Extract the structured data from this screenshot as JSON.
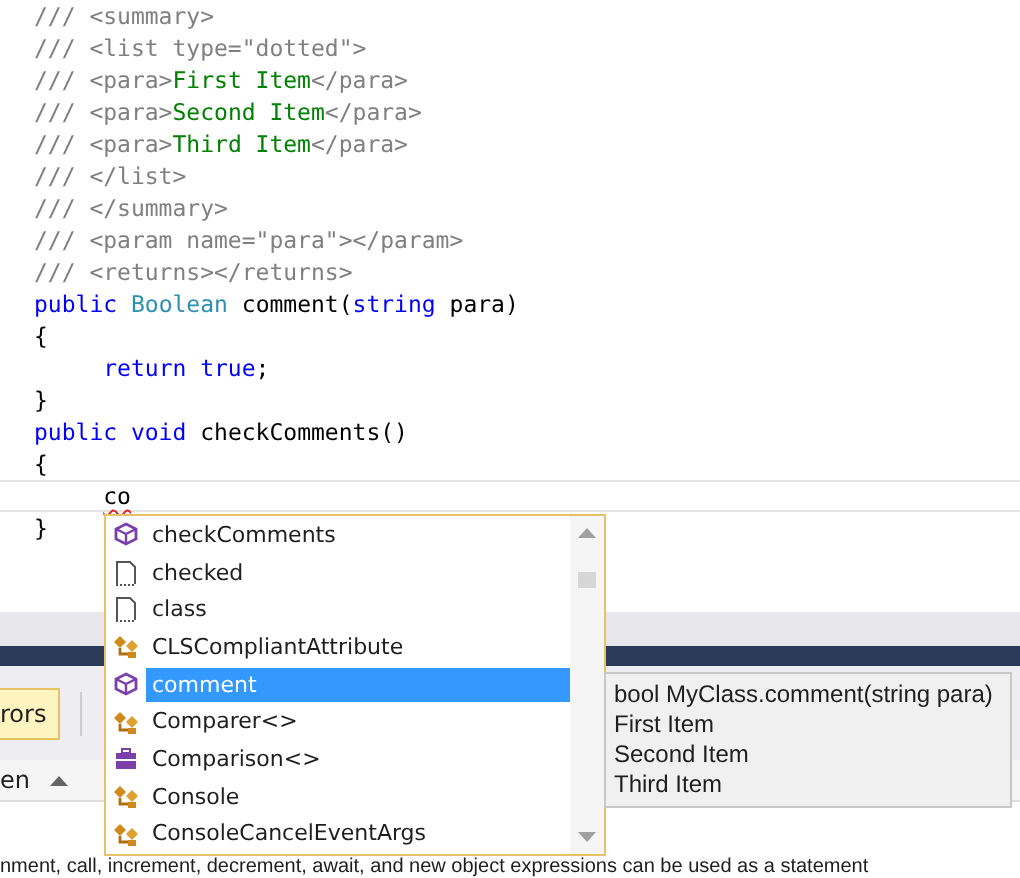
{
  "code_lines": [
    {
      "kind": "code",
      "segments": [
        {
          "text": "/// <summary>",
          "kind": "doc"
        }
      ]
    },
    {
      "kind": "code",
      "segments": [
        {
          "text": "/// <list type=\"dotted\">",
          "kind": "doc"
        }
      ]
    },
    {
      "kind": "code",
      "segments": [
        {
          "text": "/// <para>",
          "kind": "doc"
        },
        {
          "text": "First Item",
          "kind": "doc_text"
        },
        {
          "text": "</para>",
          "kind": "doc"
        }
      ]
    },
    {
      "kind": "code",
      "segments": [
        {
          "text": "/// <para>",
          "kind": "doc"
        },
        {
          "text": "Second Item",
          "kind": "doc_text"
        },
        {
          "text": "</para>",
          "kind": "doc"
        }
      ]
    },
    {
      "kind": "code",
      "segments": [
        {
          "text": "/// <para>",
          "kind": "doc"
        },
        {
          "text": "Third Item",
          "kind": "doc_text"
        },
        {
          "text": "</para>",
          "kind": "doc"
        }
      ]
    },
    {
      "kind": "code",
      "segments": [
        {
          "text": "/// </list>",
          "kind": "doc"
        }
      ]
    },
    {
      "kind": "code",
      "segments": [
        {
          "text": "/// </summary>",
          "kind": "doc"
        }
      ]
    },
    {
      "kind": "code",
      "segments": [
        {
          "text": "/// <param name=\"para\"></param>",
          "kind": "doc"
        }
      ]
    },
    {
      "kind": "code",
      "segments": [
        {
          "text": "/// <returns></returns>",
          "kind": "doc"
        }
      ]
    },
    {
      "kind": "code",
      "segments": [
        {
          "text": "public",
          "kind": "keyword"
        },
        {
          "text": " Boolean",
          "kind": "type"
        },
        {
          "text": " comment(",
          "kind": "plain"
        },
        {
          "text": "string",
          "kind": "keyword"
        },
        {
          "text": " para)",
          "kind": "plain"
        }
      ]
    },
    {
      "kind": "code",
      "segments": [
        {
          "text": "{",
          "kind": "plain"
        }
      ]
    },
    {
      "kind": "code",
      "segments": [
        {
          "text": "\treturn true",
          "kind": "keyword"
        },
        {
          "text": ";",
          "kind": "plain"
        }
      ]
    },
    {
      "kind": "code",
      "segments": [
        {
          "text": "}",
          "kind": "plain"
        }
      ]
    },
    {
      "kind": "code",
      "segments": [
        {
          "text": "public void",
          "kind": "keyword"
        },
        {
          "text": " checkComments()",
          "kind": "plain"
        }
      ]
    },
    {
      "kind": "code",
      "segments": [
        {
          "text": "{",
          "kind": "plain"
        }
      ]
    },
    {
      "kind": "current",
      "segments": [
        {
          "text": "\tco",
          "kind": "error"
        }
      ]
    },
    {
      "kind": "code",
      "segments": [
        {
          "text": "}",
          "kind": "plain"
        }
      ]
    }
  ],
  "completion": {
    "items": [
      {
        "label": "checkComments",
        "kind": "method",
        "selected": false
      },
      {
        "label": "checked",
        "kind": "keyword",
        "selected": false
      },
      {
        "label": "class",
        "kind": "keyword",
        "selected": false
      },
      {
        "label": "CLSCompliantAttribute",
        "kind": "class",
        "selected": false
      },
      {
        "label": "comment",
        "kind": "method",
        "selected": true
      },
      {
        "label": "Comparer<>",
        "kind": "class",
        "selected": false
      },
      {
        "label": "Comparison<>",
        "kind": "delegate",
        "selected": false
      },
      {
        "label": "Console",
        "kind": "class",
        "selected": false
      },
      {
        "label": "ConsoleCancelEventArgs",
        "kind": "class",
        "selected": false
      }
    ]
  },
  "tooltip": {
    "lines": [
      "bool MyClass.comment(string para)",
      "First Item",
      "Second Item",
      "Third Item"
    ]
  },
  "error_panel": {
    "tab": "rors",
    "column_header": "en",
    "description": "nment, call, increment, decrement, await, and new object expressions can be used as a statement"
  }
}
